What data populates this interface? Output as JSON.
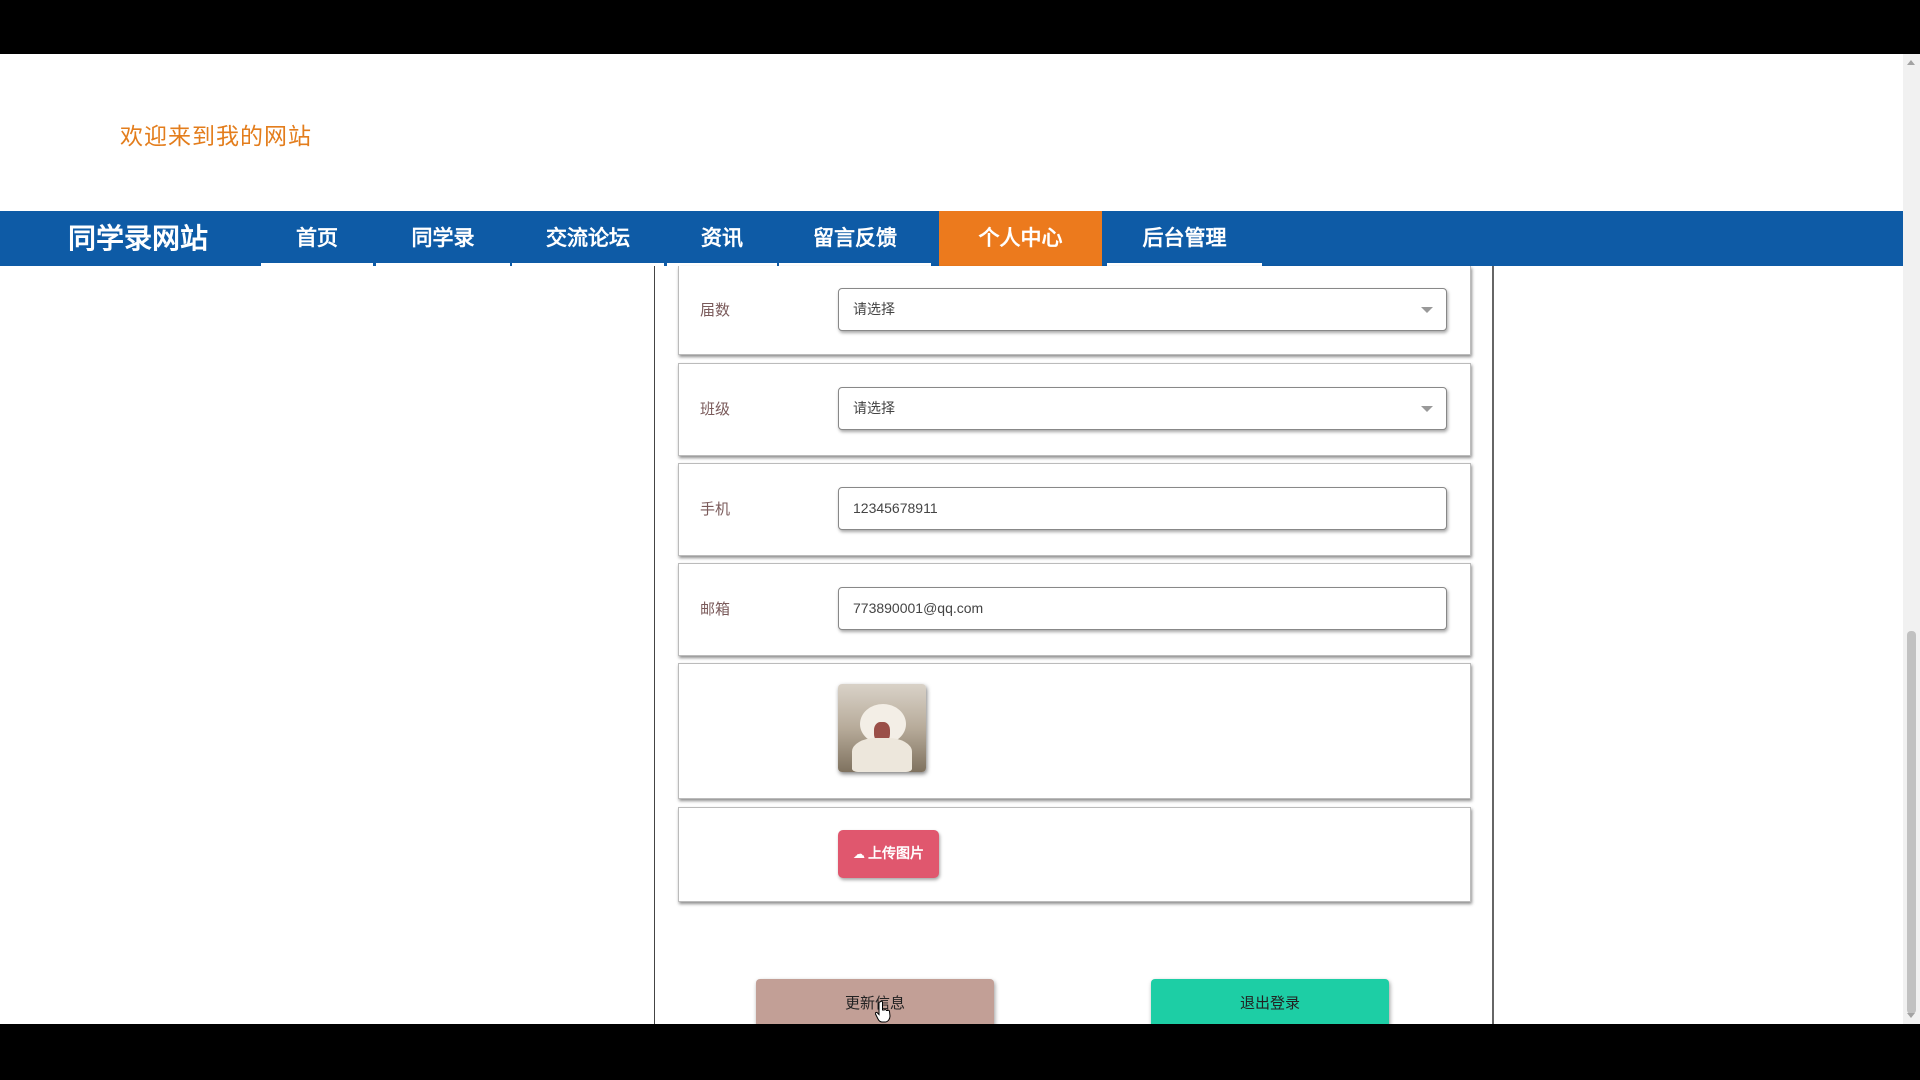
{
  "header": {
    "welcome": "欢迎来到我的网站"
  },
  "nav": {
    "brand": "同学录网站",
    "items": [
      {
        "label": "首页",
        "active": false
      },
      {
        "label": "同学录",
        "active": false
      },
      {
        "label": "交流论坛",
        "active": false
      },
      {
        "label": "资讯",
        "active": false
      },
      {
        "label": "留言反馈",
        "active": false
      },
      {
        "label": "个人中心",
        "active": true
      },
      {
        "label": "后台管理",
        "active": false
      }
    ]
  },
  "form": {
    "session": {
      "label": "届数",
      "value": "请选择"
    },
    "class": {
      "label": "班级",
      "value": "请选择"
    },
    "phone": {
      "label": "手机",
      "value": "12345678911"
    },
    "email": {
      "label": "邮箱",
      "value": "773890001@qq.com"
    },
    "upload_label": "上传图片",
    "update_label": "更新信息",
    "logout_label": "退出登录"
  },
  "colors": {
    "nav_bg": "#0e5ba6",
    "nav_active": "#ec7a1d",
    "welcome": "#e37d1c",
    "upload": "#e0576e",
    "update": "#c29f96",
    "logout": "#1dcea5"
  }
}
